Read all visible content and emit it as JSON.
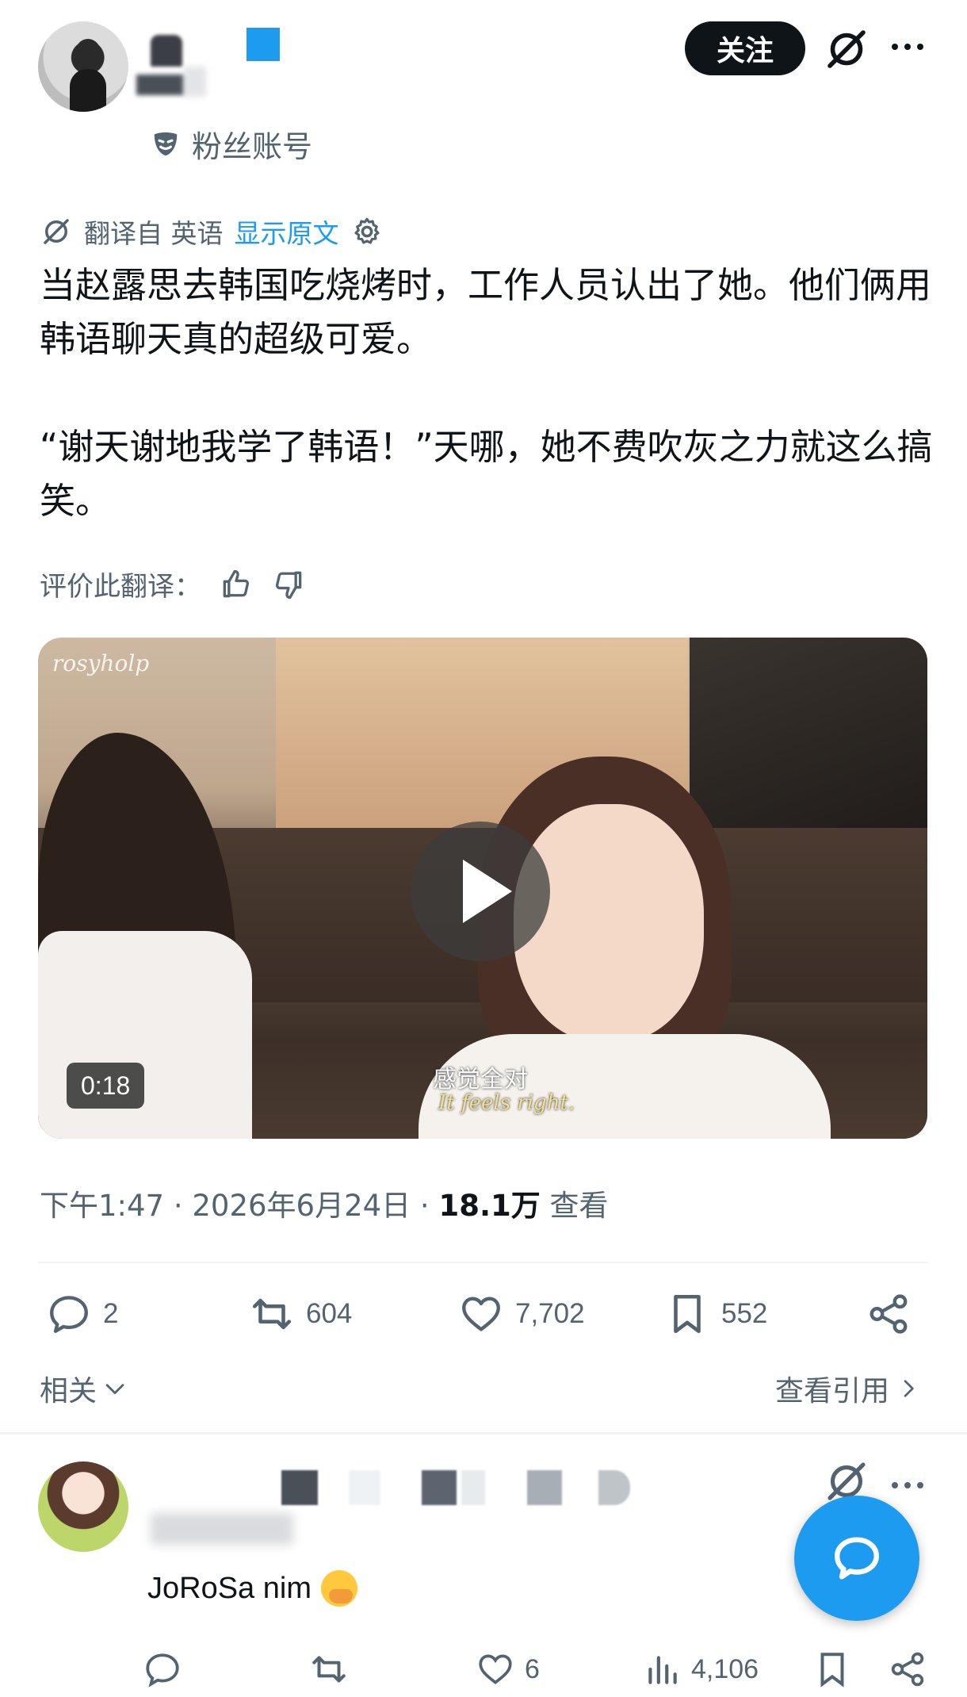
{
  "header": {
    "follow_label": "关注",
    "fan_label": "粉丝账号"
  },
  "translation": {
    "translated_from": "翻译自 英语",
    "show_original": "显示原文"
  },
  "tweet": {
    "paragraph1": "当赵露思去韩国吃烧烤时，工作人员认出了她。他们俩用韩语聊天真的超级可爱。",
    "paragraph2": "“谢天谢地我学了韩语！”天哪，她不费吹灰之力就这么搞笑。"
  },
  "rate": {
    "label": "评价此翻译："
  },
  "video": {
    "watermark": "rosyholp",
    "subtitle_cn": "感觉全对",
    "subtitle_en": "It feels right.",
    "duration": "0:18"
  },
  "meta": {
    "time_date": "下午1:47 · 2026年6月24日 · ",
    "views_count": "18.1万",
    "views_label": " 查看"
  },
  "actions": {
    "replies": "2",
    "reposts": "604",
    "likes": "7,702",
    "bookmarks": "552"
  },
  "links": {
    "related": "相关",
    "view_quotes": "查看引用"
  },
  "reply": {
    "text": "JoRoSa nim",
    "likes": "6",
    "views": "4,106"
  },
  "colors": {
    "accent": "#1d9bf0",
    "text": "#0f1419",
    "muted": "#536471"
  }
}
